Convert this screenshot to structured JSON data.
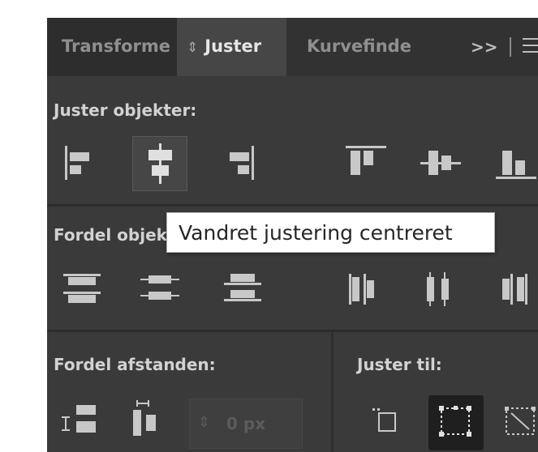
{
  "tabs": [
    {
      "label": "Transforme"
    },
    {
      "label": "Juster",
      "arrows": "⇕"
    },
    {
      "label": "Kurvefinde"
    }
  ],
  "tabbar": {
    "more": ">>"
  },
  "sections": {
    "align_objects": "Juster objekter:",
    "distribute_objects": "Fordel objekter:",
    "distribute_spacing": "Fordel afstanden:",
    "align_to": "Juster til:"
  },
  "tooltip": "Vandret justering centreret",
  "spacing_value": "0 px",
  "icons": {
    "align": [
      "align-left-icon",
      "align-horizontal-center-icon",
      "align-right-icon",
      "align-top-icon",
      "align-vertical-center-icon",
      "align-bottom-icon"
    ],
    "distribute": [
      "distribute-top-icon",
      "distribute-vertical-center-icon",
      "distribute-bottom-icon",
      "distribute-left-icon",
      "distribute-horizontal-center-icon",
      "distribute-right-icon"
    ],
    "spacing": [
      "distribute-vertical-space-icon",
      "distribute-horizontal-space-icon"
    ],
    "align_to": [
      "align-to-key-object-icon",
      "align-to-selection-icon",
      "align-to-artboard-icon"
    ]
  }
}
